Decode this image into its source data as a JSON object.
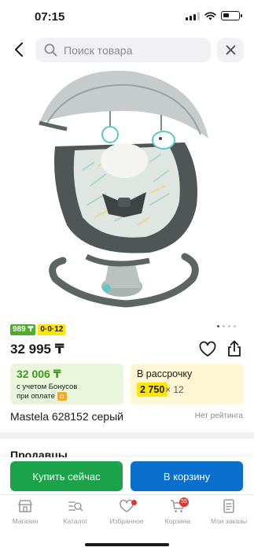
{
  "status": {
    "time": "07:15"
  },
  "search": {
    "placeholder": "Поиск товара"
  },
  "product": {
    "badges": {
      "rating_code": "989 ₸",
      "installment_code": "0·0·12"
    },
    "price": "32 995 ₸",
    "bonus": {
      "price": "32 006 ₸",
      "line1": "с учетом Бонусов",
      "line2": "при оплате"
    },
    "credit": {
      "title": "В рассрочку",
      "amount": "2 750",
      "months": "× 12"
    },
    "title": "Mastela 628152 серый",
    "rating_text": "Нет рейтинга",
    "image_count": 4,
    "active_image": 1
  },
  "sections": {
    "sellers": "Продавцы"
  },
  "actions": {
    "buy": "Купить сейчас",
    "cart": "В корзину"
  },
  "tabbar": {
    "items": [
      {
        "label": "Магазин",
        "icon": "shop-icon"
      },
      {
        "label": "Каталог",
        "icon": "catalog-icon"
      },
      {
        "label": "Избранное",
        "icon": "heart-icon",
        "dot": true
      },
      {
        "label": "Корзина",
        "icon": "cart-icon",
        "count": "55"
      },
      {
        "label": "Мои заказы",
        "icon": "orders-icon"
      }
    ]
  },
  "colors": {
    "buy": "#1aa34a",
    "cart": "#0a6fcc",
    "bonus_bg": "#e9f6dc",
    "credit_bg": "#fff6d3",
    "badge_red": "#e8342e"
  }
}
